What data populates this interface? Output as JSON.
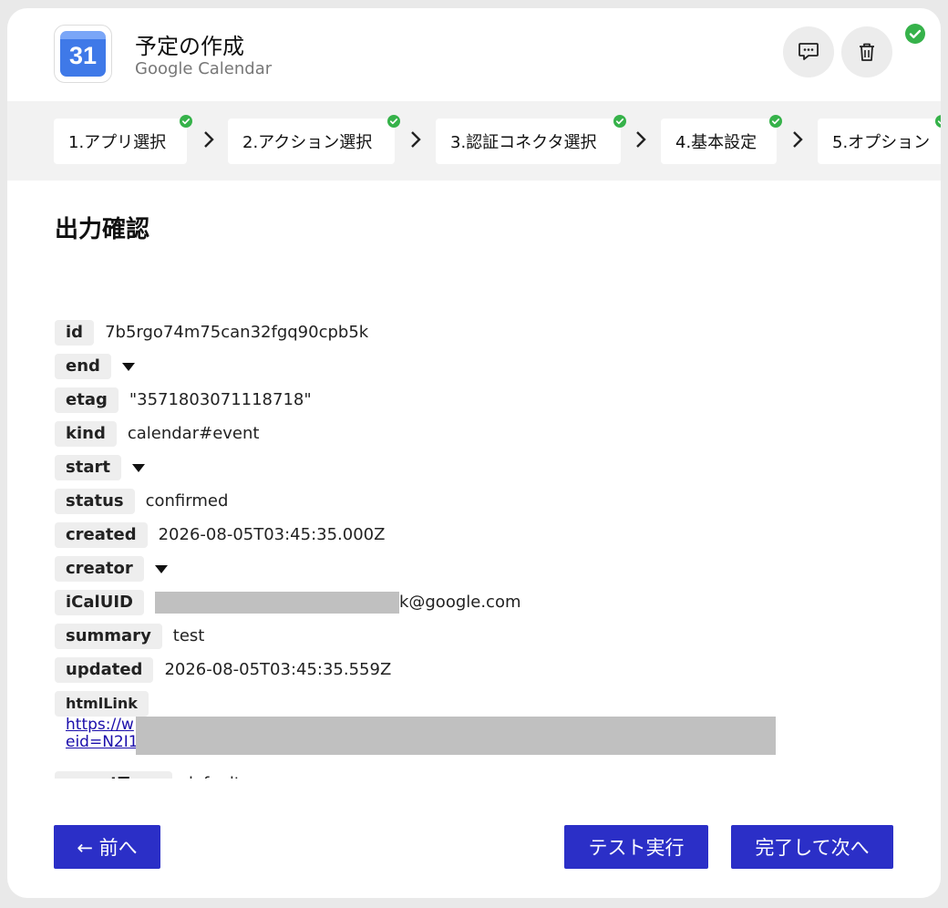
{
  "header": {
    "app_icon_text": "31",
    "title": "予定の作成",
    "subtitle": "Google Calendar"
  },
  "steps": [
    {
      "label": "1.アプリ選択",
      "done": true
    },
    {
      "label": "2.アクション選択",
      "done": true
    },
    {
      "label": "3.認証コネクタ選択",
      "done": true
    },
    {
      "label": "4.基本設定",
      "done": true
    },
    {
      "label": "5.オプション",
      "done": true
    }
  ],
  "section_title": "出力確認",
  "output": {
    "id": {
      "key": "id",
      "value": "7b5rgo74m75can32fgq90cpb5k"
    },
    "end": {
      "key": "end"
    },
    "etag": {
      "key": "etag",
      "value": "\"3571803071118718\""
    },
    "kind": {
      "key": "kind",
      "value": "calendar#event"
    },
    "start": {
      "key": "start"
    },
    "status": {
      "key": "status",
      "value": "confirmed"
    },
    "created": {
      "key": "created",
      "value": "2026-08-05T03:45:35.000Z"
    },
    "creator": {
      "key": "creator"
    },
    "icaluid": {
      "key": "iCalUID",
      "value_suffix": "k@google.com"
    },
    "summary": {
      "key": "summary",
      "value": "test"
    },
    "updated": {
      "key": "updated",
      "value": "2026-08-05T03:45:35.559Z"
    },
    "htmllink": {
      "key": "htmlLink",
      "line1": "https://w",
      "line2": "eid=N2I1"
    },
    "eventtype": {
      "key": "eventType",
      "value": "default"
    }
  },
  "buttons": {
    "prev": "← 前へ",
    "test": "テスト実行",
    "next": "完了して次へ"
  },
  "colors": {
    "accent": "#2b2fc7",
    "success": "#36b24a"
  }
}
